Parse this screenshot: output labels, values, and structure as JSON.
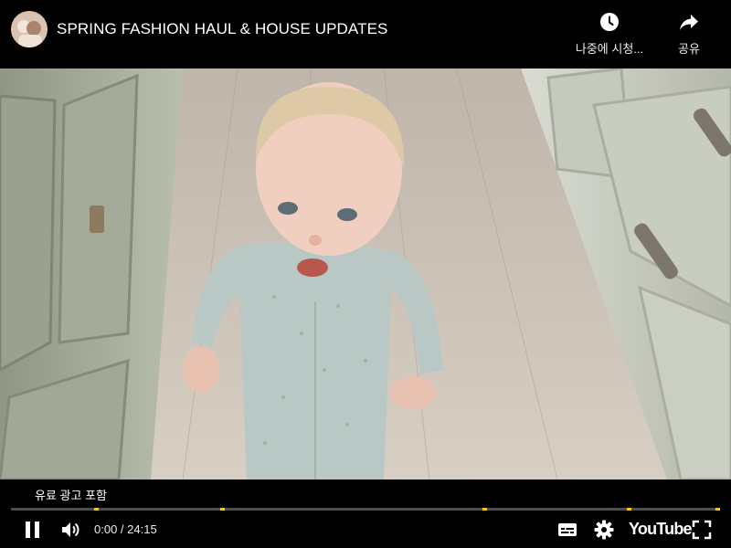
{
  "video": {
    "title": "SPRING FASHION HAUL & HOUSE UPDATES"
  },
  "top_actions": {
    "watch_later_label": "나중에 시청...",
    "watch_later_icon": "clock-icon",
    "share_label": "공유",
    "share_icon": "share-arrow-icon"
  },
  "player": {
    "ad_label": "유료 광고 포함",
    "time_display": "0:00 / 24:15",
    "progress_fraction": 0.0,
    "ad_marker_fractions": [
      0.117,
      0.295,
      0.665,
      0.868,
      0.997
    ],
    "brand": "YouTube",
    "icons": {
      "play_pause": "pause-icon",
      "volume": "volume-icon",
      "subtitles": "subtitles-icon",
      "settings": "gear-icon",
      "fullscreen": "fullscreen-icon"
    },
    "colors": {
      "progress_track": "#ffffff4d",
      "progress_played": "#ff0000",
      "ad_marker": "#f5c518"
    }
  }
}
